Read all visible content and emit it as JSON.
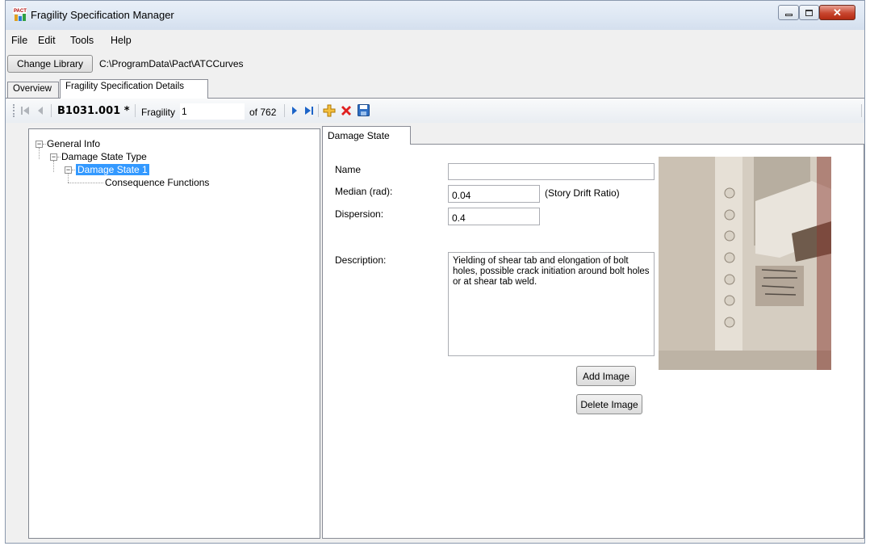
{
  "window": {
    "title": "Fragility Specification Manager",
    "app_icon": "pact-icon"
  },
  "menu": {
    "items": [
      "File",
      "Edit",
      "Tools",
      "Help"
    ]
  },
  "library": {
    "change_label": "Change Library",
    "path": "C:\\ProgramData\\Pact\\ATCCurves"
  },
  "tabs": {
    "overview": "Overview",
    "details": "Fragility Specification Details"
  },
  "nav": {
    "code": "B1031.001 *",
    "fragility_label": "Fragility",
    "index": "1",
    "of_total": "of 762"
  },
  "tree": {
    "root": "General Info",
    "child": "Damage State Type",
    "selected": "Damage State 1",
    "leaf": "Consequence Functions"
  },
  "damage_state": {
    "tab_label": "Damage State",
    "name_label": "Name",
    "name_value": "",
    "median_label": "Median (rad):",
    "median_value": "0.04",
    "median_unit": "(Story Drift Ratio)",
    "dispersion_label": "Dispersion:",
    "dispersion_value": "0.4",
    "description_label": "Description:",
    "description_value": "Yielding of shear tab and elongation of bolt holes, possible crack initiation around bolt holes or at shear tab weld.",
    "add_image": "Add Image",
    "delete_image": "Delete Image"
  },
  "colors": {
    "selection": "#3399ff",
    "close_button": "#c8462f",
    "add_icon": "#e8a000",
    "delete_icon": "#e02020",
    "nav_arrow": "#1c64c8"
  }
}
